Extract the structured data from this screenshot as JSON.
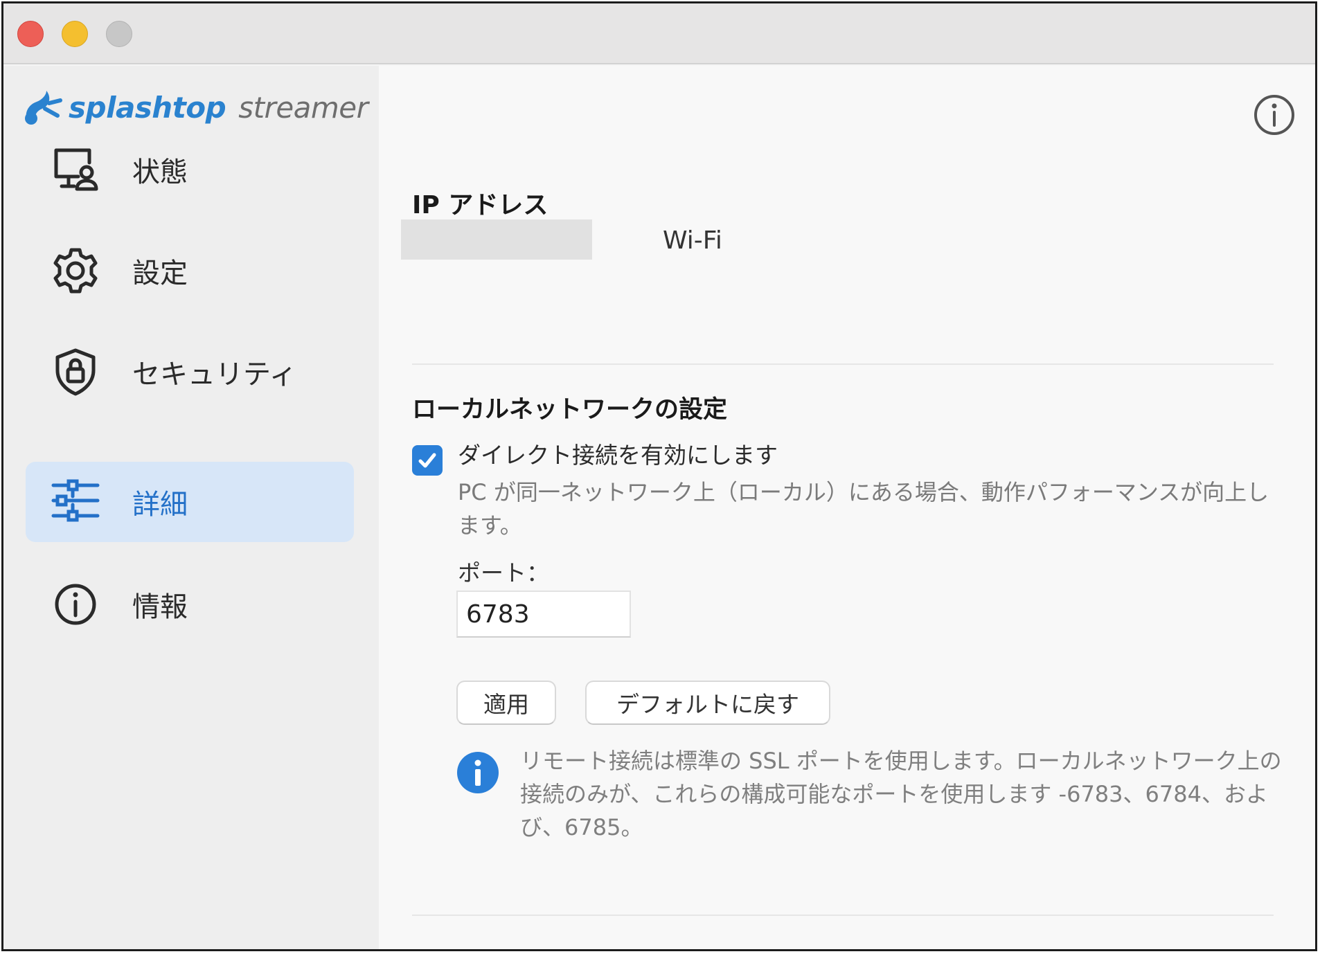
{
  "window": {
    "traffic_lights": [
      "close",
      "minimize",
      "zoom"
    ]
  },
  "sidebar": {
    "logo": {
      "brand": "splashtop",
      "product": "streamer"
    },
    "items": [
      {
        "label": "状態",
        "icon": "monitor-user-icon",
        "active": false
      },
      {
        "label": "設定",
        "icon": "gear-icon",
        "active": false
      },
      {
        "label": "セキュリティ",
        "icon": "shield-lock-icon",
        "active": false
      },
      {
        "label": "詳細",
        "icon": "sliders-icon",
        "active": true
      },
      {
        "label": "情報",
        "icon": "info-icon",
        "active": false
      }
    ]
  },
  "main": {
    "ip_section": {
      "title": "IP アドレス",
      "connection_type": "Wi-Fi"
    },
    "local_network": {
      "title": "ローカルネットワークの設定",
      "direct_connection": {
        "label": "ダイレクト接続を有効にします",
        "checked": true,
        "description": "PC が同一ネットワーク上（ローカル）にある場合、動作パフォーマンスが向上します。"
      },
      "port_label": "ポート：",
      "port_value": "6783",
      "apply_button": "適用",
      "reset_button": "デフォルトに戻す",
      "note": "リモート接続は標準の SSL ポートを使用します。ローカルネットワーク上の接続のみが、これらの構成可能なポートを使用します -6783、6784、および、6785。"
    }
  },
  "colors": {
    "accent": "#2a7fd8",
    "active_bg": "#d7e6f8",
    "brand": "#2a82cf"
  }
}
